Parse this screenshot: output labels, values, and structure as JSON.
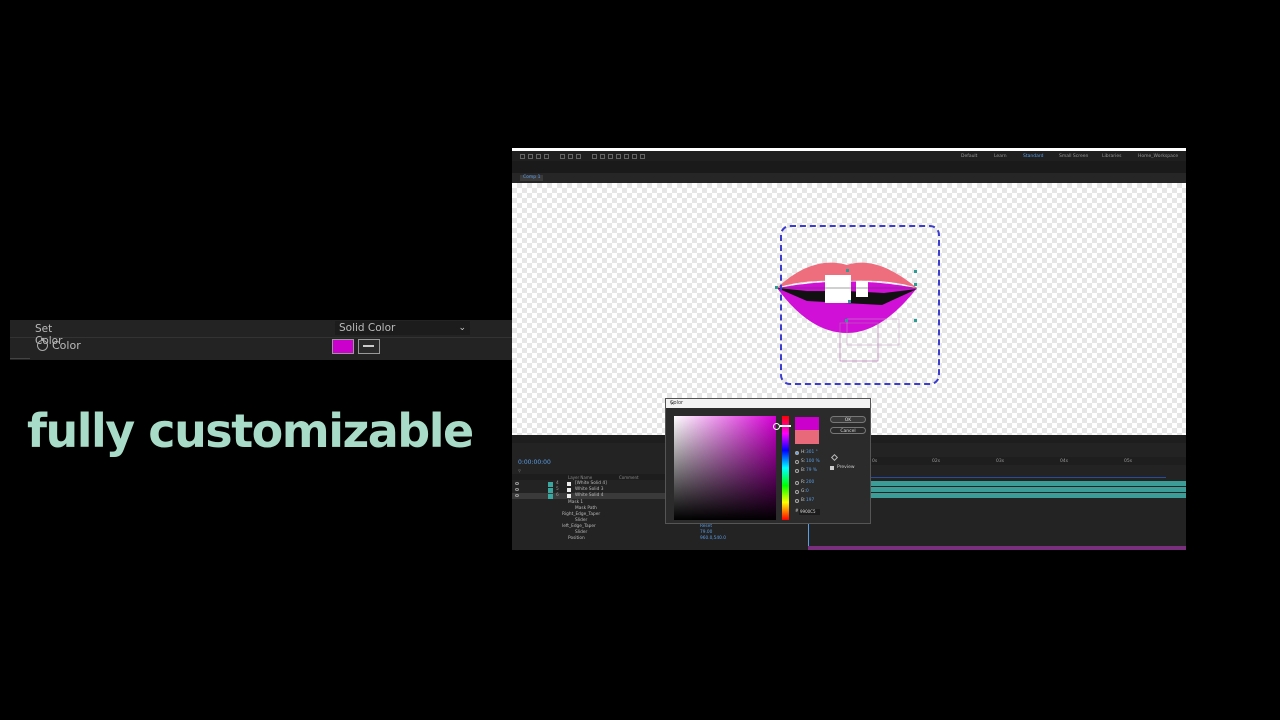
{
  "effect_panel": {
    "set_color_label": "Set Color",
    "set_color_value": "Solid Color",
    "color_label": "Color",
    "swatch_color": "#cc00cc"
  },
  "caption": "fully customizable",
  "ae": {
    "workspaces": [
      "Default",
      "Learn",
      "Standard",
      "Small Screen",
      "Libraries",
      "Home_Workspace"
    ],
    "active_workspace": "Standard",
    "comp_chip": "Comp 1",
    "timeline": {
      "timecode": "0:00:00:00",
      "col_layer_name": "Layer Name",
      "col_comment": "Comment",
      "layers": [
        {
          "num": "4",
          "name": "[White Solid 4]"
        },
        {
          "num": "5",
          "name": "White Solid 3"
        },
        {
          "num": "6",
          "name": "White Solid 4"
        }
      ],
      "props": [
        "Mask 1",
        "Mask Path",
        "Right_Edge_Taper",
        "Slider",
        "left_Edge_Taper",
        "Slider",
        "Position"
      ],
      "prop_values": [
        "Reset",
        "79.00",
        "960.0,540.0"
      ],
      "ruler": [
        "0s",
        "02s",
        "03s",
        "04s",
        "05s"
      ]
    }
  },
  "picker": {
    "title": "Color",
    "ok": "OK",
    "cancel": "Cancel",
    "new_color": "#cc00cc",
    "old_color": "#e86a7a",
    "fields": [
      {
        "label": "H:",
        "value": "301 °"
      },
      {
        "label": "S:",
        "value": "100 %"
      },
      {
        "label": "B:",
        "value": "79 %"
      },
      {
        "label": "R:",
        "value": "200"
      },
      {
        "label": "G:",
        "value": "0"
      },
      {
        "label": "B:",
        "value": "197"
      }
    ],
    "hex_label": "#",
    "hex": "9900C5",
    "preview_label": "Preview"
  }
}
